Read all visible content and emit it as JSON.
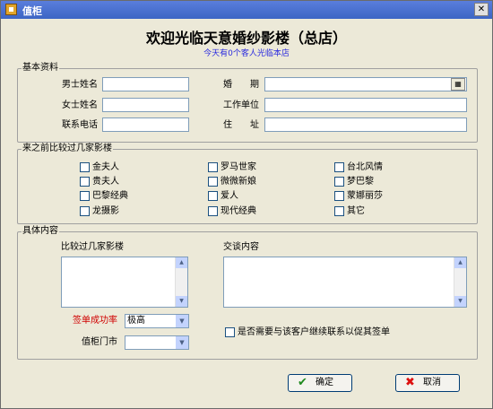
{
  "window": {
    "title": "值柜",
    "close": "✕"
  },
  "heading": "欢迎光临天意婚纱影楼（总店）",
  "subheading": "今天有0个客人光临本店",
  "basic": {
    "title": "基本资料",
    "groom_label": "男士姓名",
    "bride_label": "女士姓名",
    "phone_label": "联系电话",
    "wedding_label": "婚　　期",
    "work_label": "工作单位",
    "address_label": "住　　址",
    "calendar_btn": "　"
  },
  "compare": {
    "title": "来之前比较过几家影楼",
    "options": [
      "金夫人",
      "罗马世家",
      "台北风情",
      "贵夫人",
      "微微新娘",
      "梦巴黎",
      "巴黎经典",
      "爱人",
      "蒙娜丽莎",
      "龙摄影",
      "现代经典",
      "其它"
    ]
  },
  "details": {
    "title": "具体内容",
    "compared_label": "比较过几家影楼",
    "talk_label": "交谈内容",
    "success_label": "签单成功率",
    "success_value": "极高",
    "store_label": "值柜门市",
    "store_value": "",
    "followup_label": "是否需要与该客户继续联系以促其签单"
  },
  "buttons": {
    "ok": "确定",
    "cancel": "取消"
  }
}
